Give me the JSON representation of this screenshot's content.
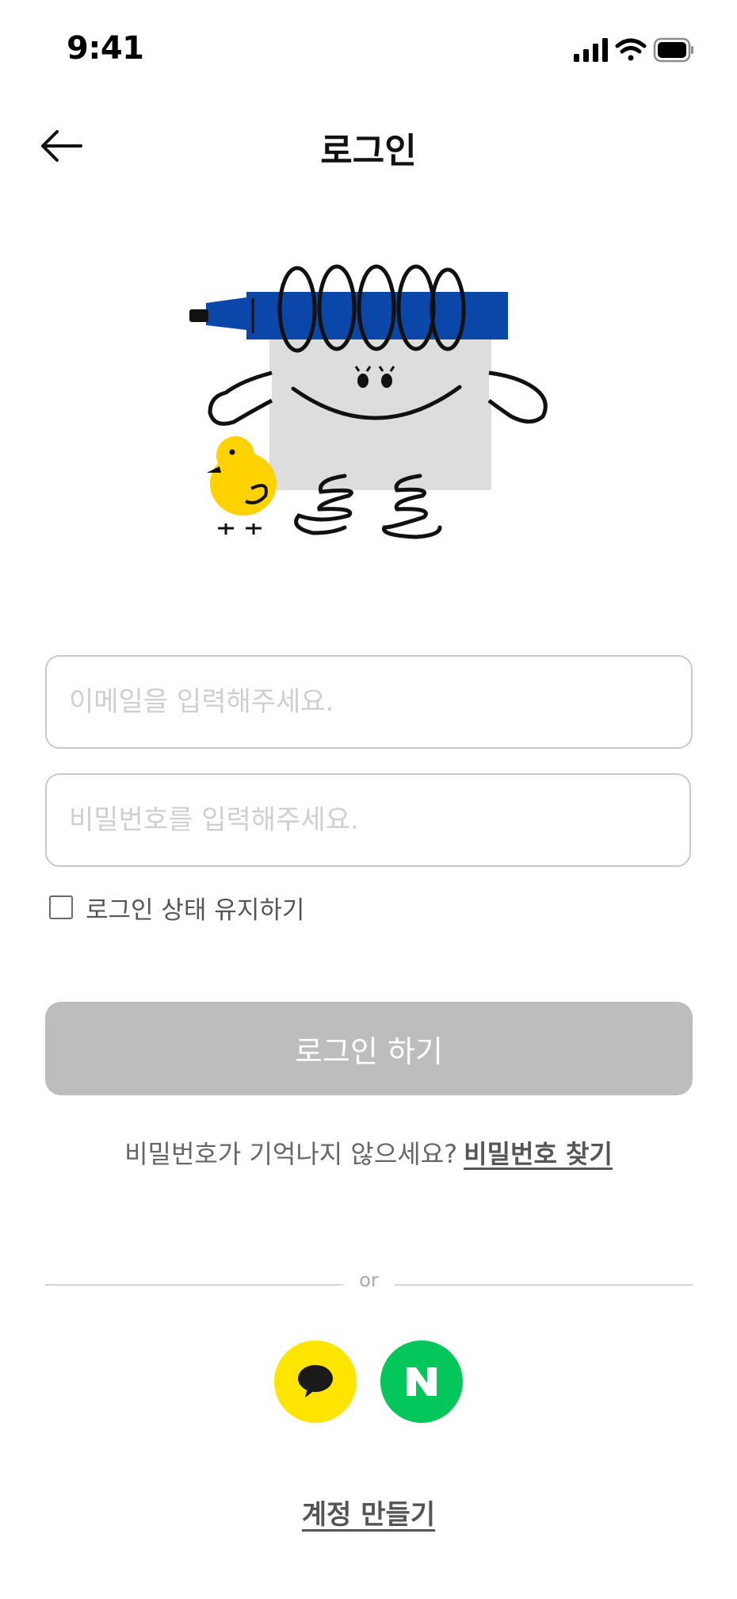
{
  "status_bar": {
    "time": "9:41",
    "icons": [
      "cellular-signal-icon",
      "wifi-icon",
      "battery-icon"
    ]
  },
  "nav": {
    "back_icon": "arrow-left-icon",
    "title": "로그인"
  },
  "illustration": {
    "description_icon": "notebook-character-illustration",
    "colors": {
      "pen": "#0A47A8",
      "body": "#DDDDDD",
      "duck": "#FFD200"
    }
  },
  "form": {
    "email_value": "",
    "email_placeholder": "이메일을 입력해주세요.",
    "password_value": "",
    "password_placeholder": "비밀번호를 입력해주세요.",
    "keep_login_label": "로그인 상태 유지하기",
    "keep_login_checked": false,
    "login_button_label": "로그인 하기"
  },
  "forgot": {
    "question": "비밀번호가 기억나지 않으세요?",
    "link_label": "비밀번호 찾기"
  },
  "divider": {
    "text": "or"
  },
  "social": {
    "kakao": {
      "icon": "kakao-speech-bubble-icon",
      "color": "#FEE500"
    },
    "naver": {
      "icon": "naver-n-icon",
      "glyph": "N",
      "color": "#03C75A"
    }
  },
  "signup": {
    "label": "계정 만들기"
  },
  "colors": {
    "disabled_button": "#BDBDBD",
    "field_border": "#C9C9C9",
    "text_primary": "#111111",
    "text_secondary": "#555555"
  }
}
